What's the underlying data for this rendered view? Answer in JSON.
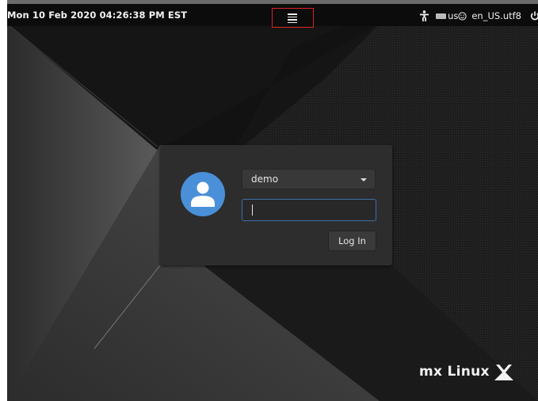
{
  "top_panel": {
    "clock": "Mon 10 Feb 2020 04:26:38 PM EST",
    "menu_icon": "hamburger-menu-icon",
    "accessibility_icon": "accessibility-person-icon",
    "keyboard_icon": "keyboard-icon",
    "keyboard_layout": "us",
    "session_icon": "smiley-icon",
    "locale": "en_US.utf8",
    "power_icon": "power-icon",
    "highlight_color": "#d22222"
  },
  "login": {
    "avatar_icon": "user-avatar-icon",
    "selected_user": "demo",
    "password_value": "",
    "login_button": "Log In",
    "accent": "#4a90d9",
    "focus_border": "#3d6fa8"
  },
  "branding": {
    "logo_text": "mx Linux",
    "logo_icon": "mx-logo-icon"
  }
}
